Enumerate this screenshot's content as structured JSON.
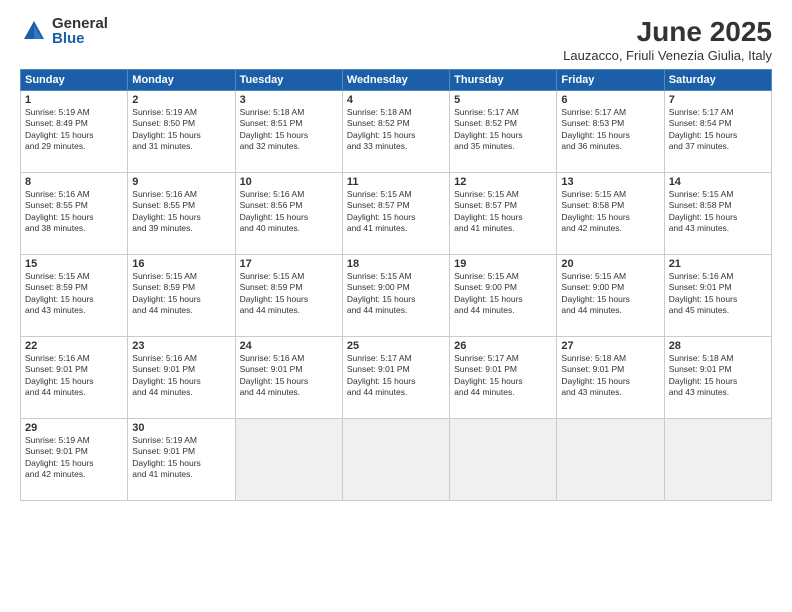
{
  "logo": {
    "general": "General",
    "blue": "Blue"
  },
  "title": "June 2025",
  "subtitle": "Lauzacco, Friuli Venezia Giulia, Italy",
  "days_of_week": [
    "Sunday",
    "Monday",
    "Tuesday",
    "Wednesday",
    "Thursday",
    "Friday",
    "Saturday"
  ],
  "weeks": [
    [
      {
        "day": "1",
        "detail": "Sunrise: 5:19 AM\nSunset: 8:49 PM\nDaylight: 15 hours\nand 29 minutes."
      },
      {
        "day": "2",
        "detail": "Sunrise: 5:19 AM\nSunset: 8:50 PM\nDaylight: 15 hours\nand 31 minutes."
      },
      {
        "day": "3",
        "detail": "Sunrise: 5:18 AM\nSunset: 8:51 PM\nDaylight: 15 hours\nand 32 minutes."
      },
      {
        "day": "4",
        "detail": "Sunrise: 5:18 AM\nSunset: 8:52 PM\nDaylight: 15 hours\nand 33 minutes."
      },
      {
        "day": "5",
        "detail": "Sunrise: 5:17 AM\nSunset: 8:52 PM\nDaylight: 15 hours\nand 35 minutes."
      },
      {
        "day": "6",
        "detail": "Sunrise: 5:17 AM\nSunset: 8:53 PM\nDaylight: 15 hours\nand 36 minutes."
      },
      {
        "day": "7",
        "detail": "Sunrise: 5:17 AM\nSunset: 8:54 PM\nDaylight: 15 hours\nand 37 minutes."
      }
    ],
    [
      {
        "day": "8",
        "detail": "Sunrise: 5:16 AM\nSunset: 8:55 PM\nDaylight: 15 hours\nand 38 minutes."
      },
      {
        "day": "9",
        "detail": "Sunrise: 5:16 AM\nSunset: 8:55 PM\nDaylight: 15 hours\nand 39 minutes."
      },
      {
        "day": "10",
        "detail": "Sunrise: 5:16 AM\nSunset: 8:56 PM\nDaylight: 15 hours\nand 40 minutes."
      },
      {
        "day": "11",
        "detail": "Sunrise: 5:15 AM\nSunset: 8:57 PM\nDaylight: 15 hours\nand 41 minutes."
      },
      {
        "day": "12",
        "detail": "Sunrise: 5:15 AM\nSunset: 8:57 PM\nDaylight: 15 hours\nand 41 minutes."
      },
      {
        "day": "13",
        "detail": "Sunrise: 5:15 AM\nSunset: 8:58 PM\nDaylight: 15 hours\nand 42 minutes."
      },
      {
        "day": "14",
        "detail": "Sunrise: 5:15 AM\nSunset: 8:58 PM\nDaylight: 15 hours\nand 43 minutes."
      }
    ],
    [
      {
        "day": "15",
        "detail": "Sunrise: 5:15 AM\nSunset: 8:59 PM\nDaylight: 15 hours\nand 43 minutes."
      },
      {
        "day": "16",
        "detail": "Sunrise: 5:15 AM\nSunset: 8:59 PM\nDaylight: 15 hours\nand 44 minutes."
      },
      {
        "day": "17",
        "detail": "Sunrise: 5:15 AM\nSunset: 8:59 PM\nDaylight: 15 hours\nand 44 minutes."
      },
      {
        "day": "18",
        "detail": "Sunrise: 5:15 AM\nSunset: 9:00 PM\nDaylight: 15 hours\nand 44 minutes."
      },
      {
        "day": "19",
        "detail": "Sunrise: 5:15 AM\nSunset: 9:00 PM\nDaylight: 15 hours\nand 44 minutes."
      },
      {
        "day": "20",
        "detail": "Sunrise: 5:15 AM\nSunset: 9:00 PM\nDaylight: 15 hours\nand 44 minutes."
      },
      {
        "day": "21",
        "detail": "Sunrise: 5:16 AM\nSunset: 9:01 PM\nDaylight: 15 hours\nand 45 minutes."
      }
    ],
    [
      {
        "day": "22",
        "detail": "Sunrise: 5:16 AM\nSunset: 9:01 PM\nDaylight: 15 hours\nand 44 minutes."
      },
      {
        "day": "23",
        "detail": "Sunrise: 5:16 AM\nSunset: 9:01 PM\nDaylight: 15 hours\nand 44 minutes."
      },
      {
        "day": "24",
        "detail": "Sunrise: 5:16 AM\nSunset: 9:01 PM\nDaylight: 15 hours\nand 44 minutes."
      },
      {
        "day": "25",
        "detail": "Sunrise: 5:17 AM\nSunset: 9:01 PM\nDaylight: 15 hours\nand 44 minutes."
      },
      {
        "day": "26",
        "detail": "Sunrise: 5:17 AM\nSunset: 9:01 PM\nDaylight: 15 hours\nand 44 minutes."
      },
      {
        "day": "27",
        "detail": "Sunrise: 5:18 AM\nSunset: 9:01 PM\nDaylight: 15 hours\nand 43 minutes."
      },
      {
        "day": "28",
        "detail": "Sunrise: 5:18 AM\nSunset: 9:01 PM\nDaylight: 15 hours\nand 43 minutes."
      }
    ],
    [
      {
        "day": "29",
        "detail": "Sunrise: 5:19 AM\nSunset: 9:01 PM\nDaylight: 15 hours\nand 42 minutes."
      },
      {
        "day": "30",
        "detail": "Sunrise: 5:19 AM\nSunset: 9:01 PM\nDaylight: 15 hours\nand 41 minutes."
      },
      {
        "day": "",
        "detail": ""
      },
      {
        "day": "",
        "detail": ""
      },
      {
        "day": "",
        "detail": ""
      },
      {
        "day": "",
        "detail": ""
      },
      {
        "day": "",
        "detail": ""
      }
    ]
  ]
}
